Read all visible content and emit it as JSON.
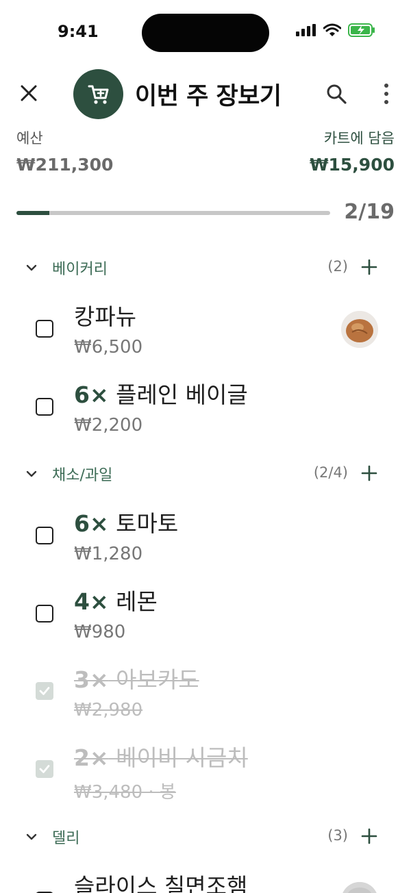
{
  "status": {
    "time": "9:41"
  },
  "header": {
    "title": "이번 주 장보기"
  },
  "budget": {
    "label": "예산",
    "value": "₩211,300"
  },
  "cart": {
    "label": "카트에 담음",
    "value": "₩15,900"
  },
  "progress": {
    "done": 2,
    "total": 19,
    "text": "2/19"
  },
  "sections": [
    {
      "name": "베이커리",
      "count": "(2)",
      "items": [
        {
          "qty": "",
          "name": "캉파뉴",
          "price": "₩6,500",
          "checked": false,
          "thumb": "bread-image"
        },
        {
          "qty": "6×",
          "name": " 플레인 베이글",
          "price": "₩2,200",
          "checked": false
        }
      ]
    },
    {
      "name": "채소/과일",
      "count": "(2/4)",
      "items": [
        {
          "qty": "6×",
          "name": " 토마토",
          "price": "₩1,280",
          "checked": false
        },
        {
          "qty": "4×",
          "name": " 레몬",
          "price": "₩980",
          "checked": false
        },
        {
          "qty": "3×",
          "name": " 아보카도",
          "price": "₩2,980",
          "checked": true
        },
        {
          "qty": "2×",
          "name": " 베이비 시금치",
          "price": "₩3,480 · 봉",
          "checked": true
        }
      ]
    },
    {
      "name": "델리",
      "count": "(3)",
      "items": [
        {
          "qty": "",
          "name": "슬라이스 칠면조햄",
          "price": "",
          "checked": false,
          "thumb": "ham-image"
        }
      ]
    }
  ],
  "colors": {
    "accent": "#2d4f3f",
    "muted": "#777777",
    "checked_box": "#d4dbd7"
  },
  "icons": [
    "close-icon",
    "cart-icon",
    "search-icon",
    "more-vertical-icon",
    "chevron-down-icon",
    "plus-icon",
    "checkmark-icon"
  ]
}
